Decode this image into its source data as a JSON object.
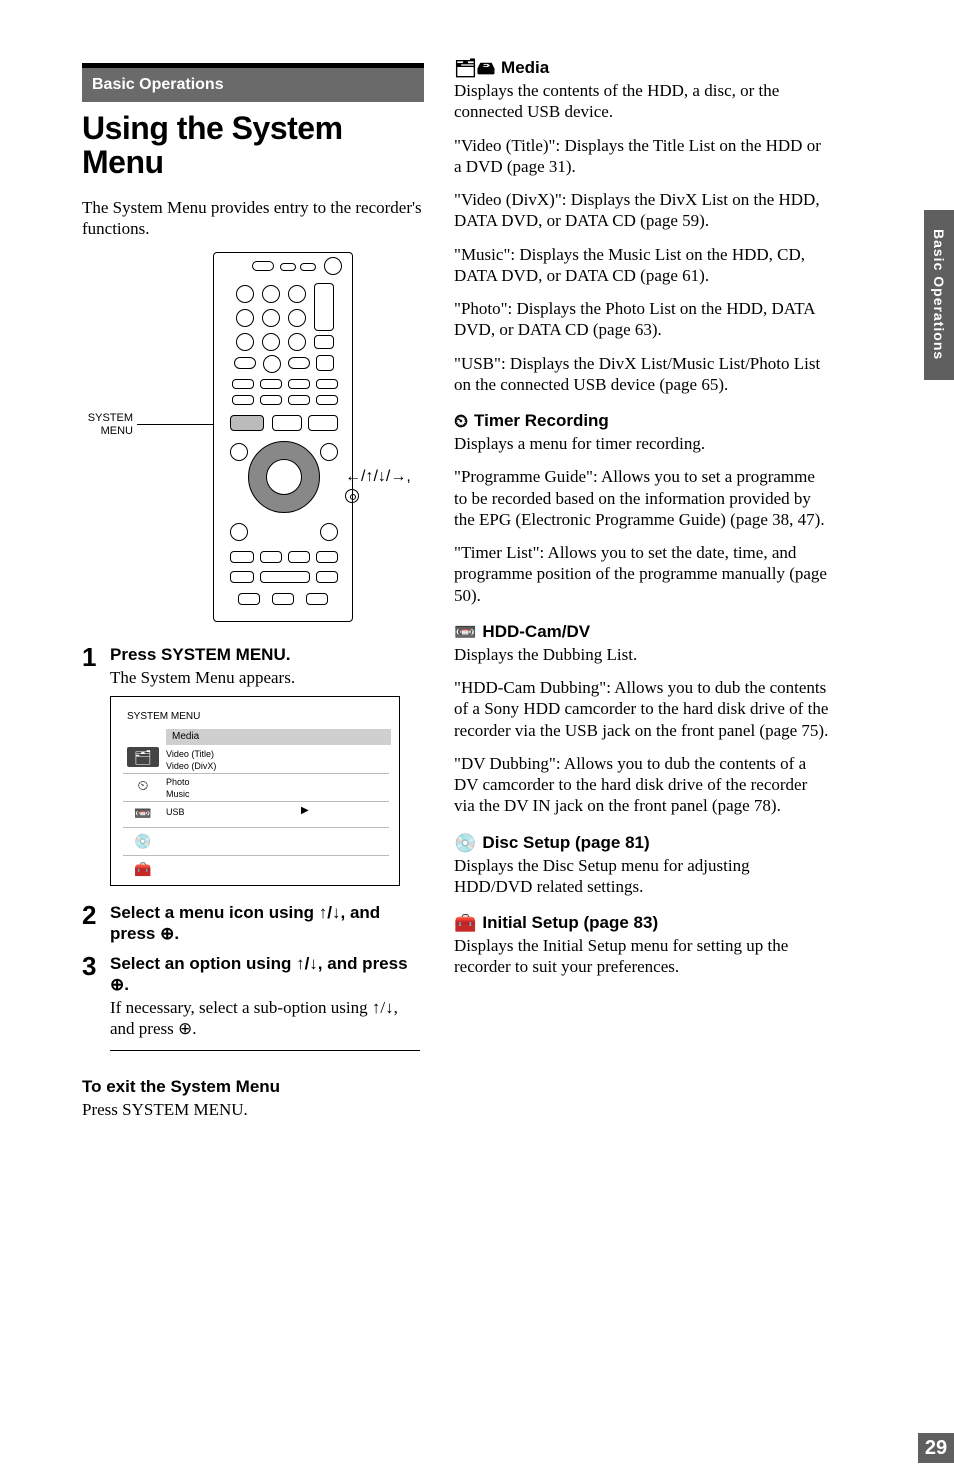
{
  "side_tab": "Basic Operations",
  "page_number": "29",
  "left": {
    "section_label": "Basic Operations",
    "title": "Using the System Menu",
    "intro": "The System Menu provides entry to the recorder's functions.",
    "remote": {
      "label_left_line1": "SYSTEM",
      "label_left_line2": "MENU",
      "label_right": "←/↑/↓/→,"
    },
    "steps": [
      {
        "num": "1",
        "head": "Press SYSTEM MENU.",
        "sub": "The System Menu appears."
      },
      {
        "num": "2",
        "head": "Select a menu icon using ↑/↓, and press ⊕."
      },
      {
        "num": "3",
        "head": "Select an option using ↑/↓, and press ⊕.",
        "sub": "If necessary, select a sub-option using ↑/↓, and press ⊕."
      }
    ],
    "screenshot": {
      "title": "SYSTEM MENU",
      "bar": "Media",
      "rows": [
        "Video (Title)",
        "Video (DivX)",
        "Photo",
        "Music",
        "USB"
      ]
    },
    "exit_head": "To exit the System Menu",
    "exit_body": "Press SYSTEM MENU."
  },
  "right": {
    "media": {
      "head": "Media",
      "p1": "Displays the contents of the HDD, a disc, or the connected USB device.",
      "p2": "\"Video (Title)\": Displays the Title List on the HDD or a DVD (page 31).",
      "p3": "\"Video (DivX)\": Displays the DivX List on the HDD, DATA DVD, or DATA CD (page 59).",
      "p4": "\"Music\": Displays the Music List on the HDD, CD, DATA DVD, or DATA CD (page 61).",
      "p5": "\"Photo\": Displays the Photo List on the HDD, DATA DVD, or DATA CD (page 63).",
      "p6": "\"USB\": Displays the DivX List/Music List/Photo List on the connected USB device (page 65)."
    },
    "timer": {
      "head": "Timer Recording",
      "p1": "Displays a menu for timer recording.",
      "p2": "\"Programme Guide\": Allows you to set a programme to be recorded based on the information provided by the EPG (Electronic Programme Guide) (page 38, 47).",
      "p3": "\"Timer List\": Allows you to set the date, time, and programme position of the programme manually (page 50)."
    },
    "hdd": {
      "head": "HDD-Cam/DV",
      "p1": "Displays the Dubbing List.",
      "p2": "\"HDD-Cam Dubbing\": Allows you to dub the contents of a Sony HDD camcorder to the hard disk drive of the recorder via the USB jack on the front panel (page 75).",
      "p3": "\"DV Dubbing\": Allows you to dub the contents of a DV camcorder to the hard disk drive of the recorder via the DV IN jack on the front panel (page 78)."
    },
    "disc": {
      "head": "Disc Setup (page 81)",
      "p1": "Displays the Disc Setup menu for adjusting HDD/DVD related settings."
    },
    "initial": {
      "head": "Initial Setup (page 83)",
      "p1": "Displays the Initial Setup menu for setting up the recorder to suit your preferences."
    }
  }
}
